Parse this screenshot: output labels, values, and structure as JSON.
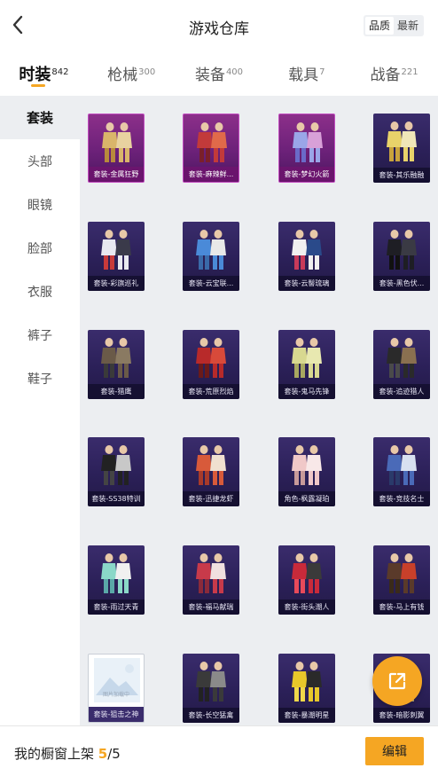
{
  "header": {
    "title": "游戏仓库",
    "back_icon": "chevron-left-icon",
    "sort_options": [
      "品质",
      "最新"
    ],
    "sort_active": "品质"
  },
  "tabs": [
    {
      "label": "时装",
      "count": "842",
      "active": true
    },
    {
      "label": "枪械",
      "count": "300",
      "active": false
    },
    {
      "label": "装备",
      "count": "400",
      "active": false
    },
    {
      "label": "载具",
      "count": "7",
      "active": false
    },
    {
      "label": "战备",
      "count": "221",
      "active": false
    }
  ],
  "sidebar": {
    "items": [
      "套装",
      "头部",
      "眼镜",
      "脸部",
      "衣服",
      "裤子",
      "鞋子"
    ],
    "active": "套装"
  },
  "grid": {
    "items": [
      {
        "caption": "套装-金属狂野",
        "style": "pink"
      },
      {
        "caption": "套装-麻辣鲜...",
        "style": "pink"
      },
      {
        "caption": "套装-梦幻火箭",
        "style": "pink"
      },
      {
        "caption": "套装-其乐融融",
        "style": "purple"
      },
      {
        "caption": "套装-彩旗巡礼",
        "style": "purple"
      },
      {
        "caption": "套装-云宝联...",
        "style": "purple"
      },
      {
        "caption": "套装-云髻琉璃",
        "style": "purple"
      },
      {
        "caption": "套装-黑色伏...",
        "style": "purple"
      },
      {
        "caption": "套装-猎鹰",
        "style": "purple"
      },
      {
        "caption": "套装-荒原烈焰",
        "style": "purple"
      },
      {
        "caption": "套装-鬼马先锋",
        "style": "purple"
      },
      {
        "caption": "套装-追迹猎人",
        "style": "purple"
      },
      {
        "caption": "套装-SS38特训",
        "style": "purple"
      },
      {
        "caption": "套装-迅捷龙虾",
        "style": "purple"
      },
      {
        "caption": "角色-枫露凝珀",
        "style": "purple"
      },
      {
        "caption": "套装-竞技名士",
        "style": "purple"
      },
      {
        "caption": "套装-雨过天青",
        "style": "purple"
      },
      {
        "caption": "套装-福马献瑞",
        "style": "purple"
      },
      {
        "caption": "套装-街头潮人",
        "style": "purple"
      },
      {
        "caption": "套装-马上有钱",
        "style": "purple"
      },
      {
        "caption": "套装-狙击之神",
        "style": "gray",
        "placeholder_text": "图片加载中"
      },
      {
        "caption": "套装-长空猛禽",
        "style": "purple"
      },
      {
        "caption": "套装-暴潮明星",
        "style": "purple"
      },
      {
        "caption": "套装-暗影刺翼",
        "style": "purple"
      }
    ]
  },
  "share_button": {
    "icon": "share-external-icon"
  },
  "bottom": {
    "shelf_label": "我的橱窗上架",
    "shelf_current": "5",
    "shelf_sep": "/",
    "shelf_total": "5",
    "edit_label": "编辑"
  },
  "colors": {
    "accent": "#f5a623",
    "card_purple": "#2b2058",
    "card_pink": "#6c2179",
    "grid_bg": "#eceef1"
  }
}
